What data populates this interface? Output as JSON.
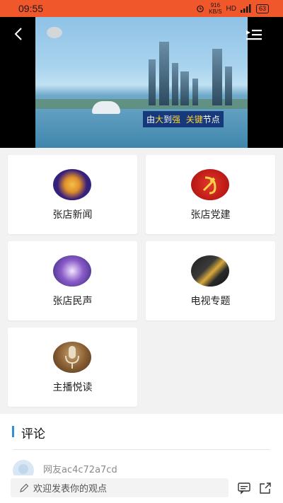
{
  "status_bar": {
    "time": "09:55",
    "net_speed_value": "916",
    "net_speed_unit": "KB/S",
    "hd": "HD",
    "battery": "63"
  },
  "video": {
    "caption_parts": [
      "由",
      "大",
      "到",
      "强",
      "关键",
      "节点"
    ]
  },
  "grid": {
    "items": [
      {
        "label": "张店新闻",
        "thumb": "news-thumbnail"
      },
      {
        "label": "张店党建",
        "thumb": "party-emblem-thumbnail"
      },
      {
        "label": "张店民声",
        "thumb": "civic-voice-thumbnail"
      },
      {
        "label": "电视专题",
        "thumb": "tv-special-thumbnail"
      },
      {
        "label": "主播悦读",
        "thumb": "microphone-thumbnail"
      }
    ]
  },
  "comments": {
    "title": "评论",
    "first_user": "网友ac4c72a7cd"
  },
  "input": {
    "placeholder": "欢迎发表你的观点"
  },
  "colors": {
    "status_bar": "#f0572a",
    "accent_bar": "#2f8fd9"
  }
}
